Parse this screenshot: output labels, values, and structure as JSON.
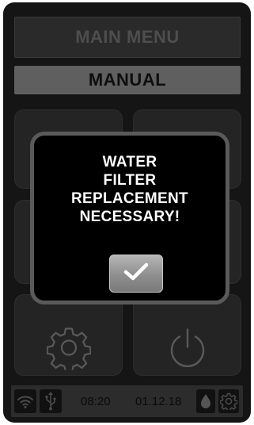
{
  "header": {
    "title": "MAIN MENU"
  },
  "mode": {
    "label": "MANUAL"
  },
  "tiles": {
    "settings_icon": "gear-icon",
    "power_icon": "power-icon"
  },
  "dialog": {
    "message_lines": [
      "WATER",
      "FILTER",
      "REPLACEMENT",
      "NECESSARY!"
    ],
    "confirm_icon": "checkmark-icon"
  },
  "status_bar": {
    "wifi_icon": "wifi-icon",
    "usb_icon": "usb-icon",
    "time": "08:20",
    "date": "01.12.18",
    "water_icon": "water-drop-icon",
    "settings_icon": "gear-icon"
  },
  "colors": {
    "background": "#151515",
    "dialog_border": "#5a5a5a",
    "mode_bar": "#5f5f5f"
  }
}
